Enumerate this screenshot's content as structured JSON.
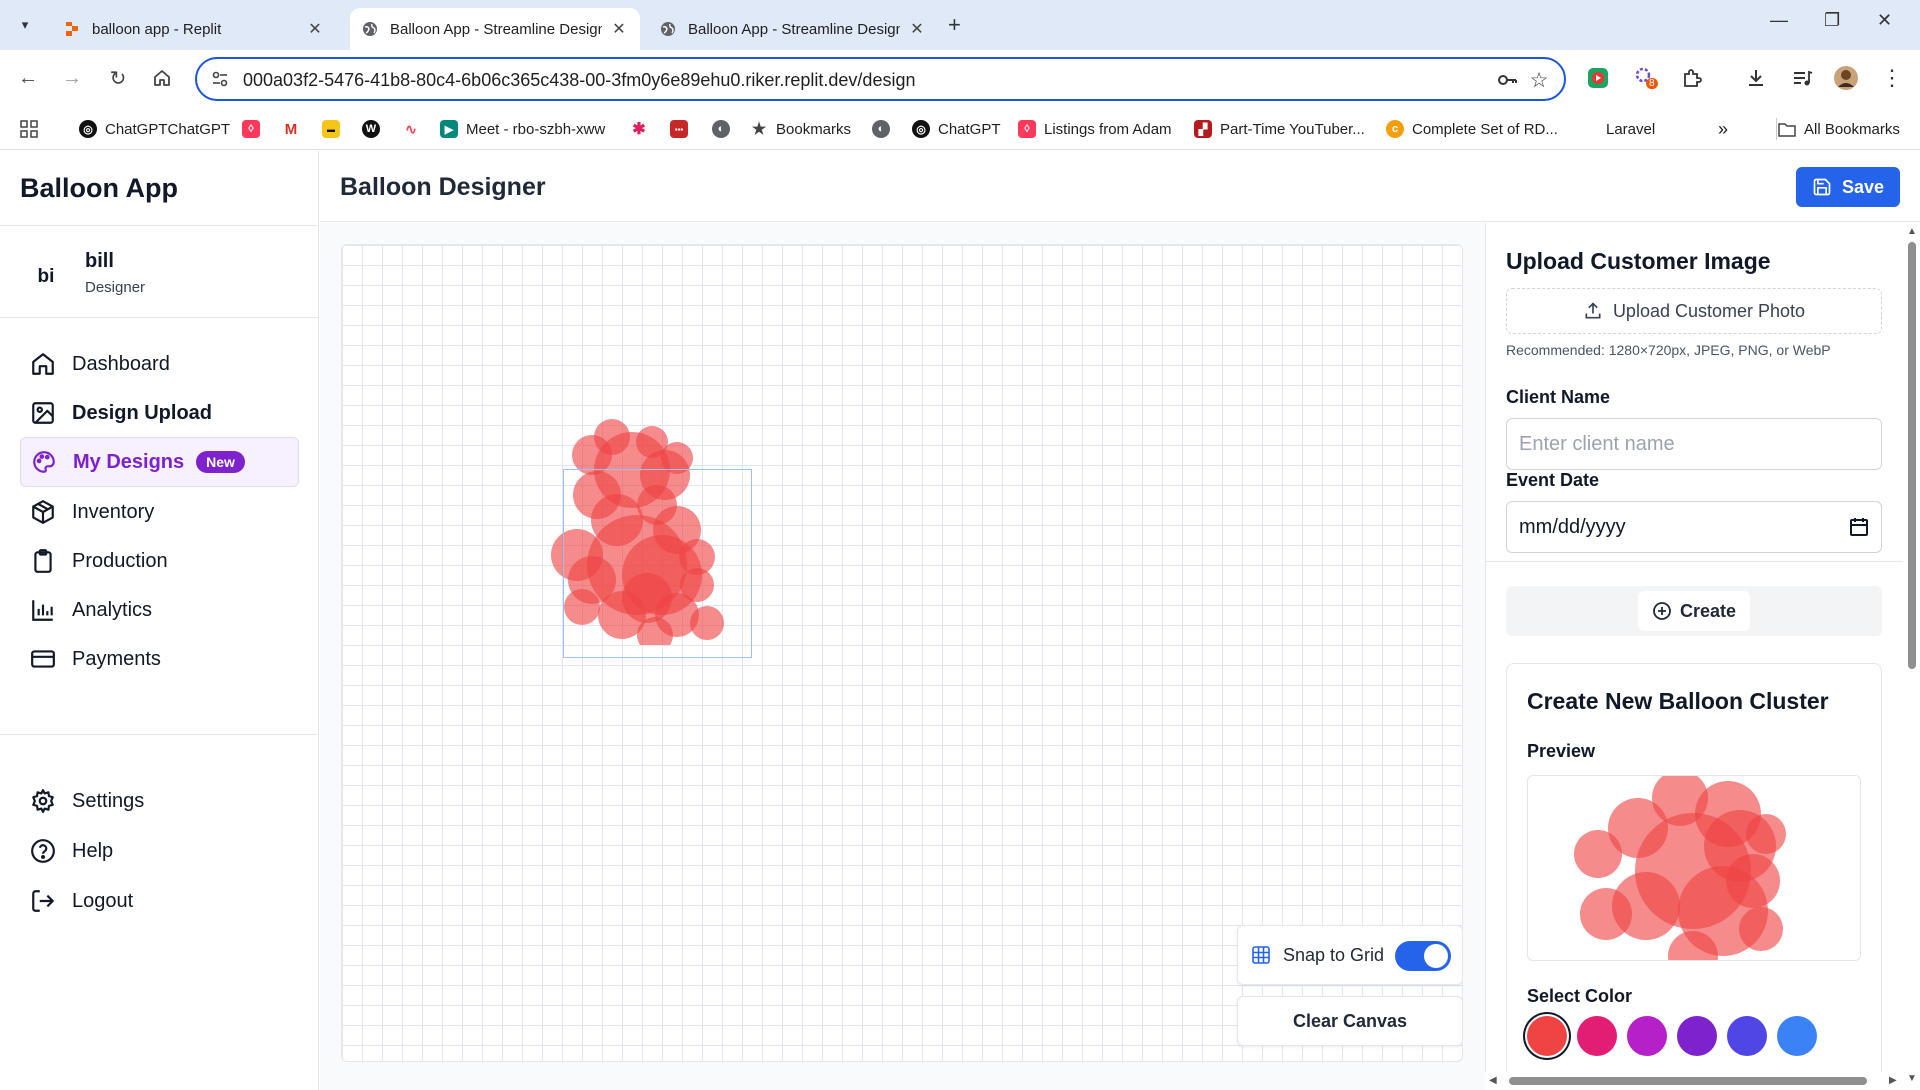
{
  "browser": {
    "tabs": [
      {
        "title": "balloon app - Replit",
        "active": false
      },
      {
        "title": "Balloon App - Streamline Design",
        "active": true
      },
      {
        "title": "Balloon App - Streamline Design",
        "active": false
      }
    ],
    "url": "000a03f2-5476-41b8-80c4-6b06c365c438-00-3fm0y6e89ehu0.riker.replit.dev/design",
    "extension_badge": "8",
    "bookmarks": [
      "ChatGPTChatGPT",
      "Meet - rbo-szbh-xww",
      "Bookmarks",
      "ChatGPT",
      "Listings from Adam",
      "Part-Time YouTuber...",
      "Complete Set of RD...",
      "Laravel",
      "All Bookmarks"
    ]
  },
  "sidebar": {
    "brand": "Balloon App",
    "user": {
      "initials": "bi",
      "name": "bill",
      "role": "Designer"
    },
    "nav": [
      {
        "label": "Dashboard",
        "icon": "home-icon"
      },
      {
        "label": "Design Upload",
        "icon": "image-icon"
      },
      {
        "label": "My Designs",
        "icon": "palette-icon",
        "badge": "New"
      },
      {
        "label": "Inventory",
        "icon": "box-icon"
      },
      {
        "label": "Production",
        "icon": "clipboard-icon"
      },
      {
        "label": "Analytics",
        "icon": "bar-chart-icon"
      },
      {
        "label": "Payments",
        "icon": "credit-card-icon"
      }
    ],
    "footer": [
      {
        "label": "Settings",
        "icon": "gear-icon"
      },
      {
        "label": "Help",
        "icon": "help-circle-icon"
      },
      {
        "label": "Logout",
        "icon": "logout-icon"
      }
    ]
  },
  "header": {
    "title": "Balloon Designer",
    "save_label": "Save"
  },
  "canvas": {
    "snap_label": "Snap to Grid",
    "snap_enabled": true,
    "clear_label": "Clear Canvas"
  },
  "panel": {
    "upload_title": "Upload Customer Image",
    "upload_button": "Upload Customer Photo",
    "upload_hint": "Recommended: 1280×720px, JPEG, PNG, or WebP",
    "client_label": "Client Name",
    "client_placeholder": "Enter client name",
    "event_label": "Event Date",
    "event_value": "mm/dd/yyyy",
    "create_label": "Create",
    "cluster_title": "Create New Balloon Cluster",
    "preview_label": "Preview",
    "color_label": "Select Color",
    "colors": [
      "#ef4444",
      "#e11d74",
      "#b620c8",
      "#7e22ce",
      "#4f46e5",
      "#3b82f6"
    ]
  }
}
